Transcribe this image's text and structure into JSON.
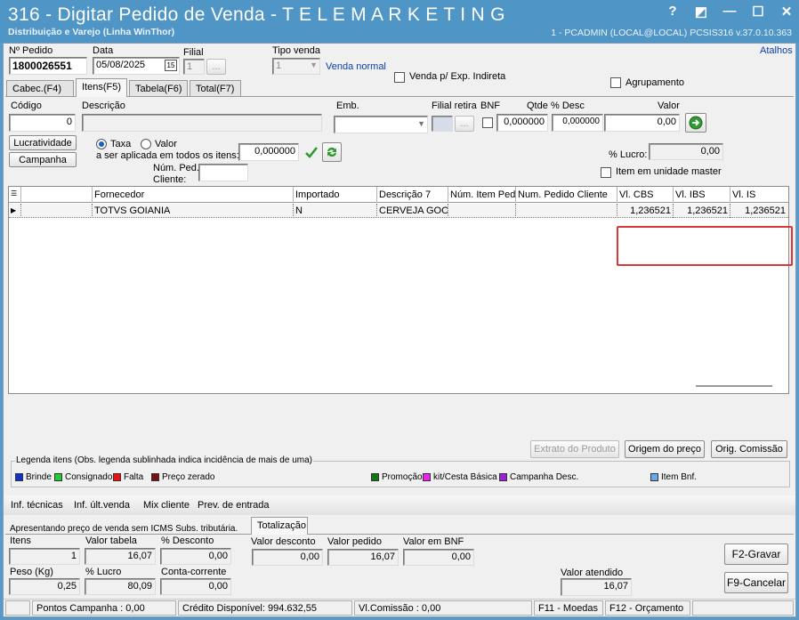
{
  "window": {
    "title": "316 - Digitar Pedido de Venda - T E L E M A R K E T I N G",
    "subtitle": "Distribuição e Varejo (Linha WinThor)",
    "session": "1 - PCADMIN (LOCAL@LOCAL)   PCSIS316  v.37.0.10.363",
    "buttons": {
      "help": "?",
      "restore": "◩",
      "minimize": "—",
      "maximize": "☐",
      "close": "✕"
    }
  },
  "header": {
    "pedido_label": "Nº Pedido",
    "pedido_value": "1800026551",
    "data_label": "Data",
    "data_value": "05/08/2025",
    "calendar_icon": "15",
    "filial_label": "Filial",
    "filial_value": "1",
    "ellipsis": "...",
    "tipo_venda_label": "Tipo venda",
    "tipo_venda_value": "1",
    "tipo_venda_desc": "Venda normal",
    "exp_indireta_label": "Venda p/ Exp. Indireta",
    "atalhos": "Atalhos",
    "agrupamento_label": "Agrupamento"
  },
  "tabs": [
    {
      "label": "Cabec.(F4)"
    },
    {
      "label": "Itens(F5)"
    },
    {
      "label": "Tabela(F6)"
    },
    {
      "label": "Total(F7)"
    }
  ],
  "item_form": {
    "codigo_label": "Código",
    "codigo_value": "0",
    "descricao_label": "Descrição",
    "descricao_value": "",
    "emb_label": "Emb.",
    "filial_retira_label": "Filial retira",
    "bnf_label": "BNF",
    "qtde_label": "Qtde",
    "qtde_value": "0,000000",
    "desc_label": "% Desc",
    "desc_value": "0,000000",
    "valor_label": "Valor",
    "valor_value": "0,00",
    "lucratividade_btn": "Lucratividade",
    "campanha_btn": "Campanha",
    "taxa_label": "Taxa",
    "valor_radio_label": "Valor",
    "aplicada_label": "a ser aplicada em todos os itens:",
    "aplicada_value": "0,000000",
    "num_ped_cliente_label1": "Núm. Ped.",
    "num_ped_cliente_label2": "Cliente:",
    "lucro_label": "% Lucro:",
    "lucro_value": "0,00",
    "unidade_master_label": "Item em unidade master"
  },
  "grid": {
    "headers": [
      "",
      "Fornecedor",
      "Importado",
      "Descrição 7",
      "Núm. Item Ped",
      "Num. Pedido Cliente",
      "Vl. CBS",
      "Vl. IBS",
      "Vl. IS"
    ],
    "rows": [
      [
        "",
        "TOTVS GOIANIA",
        "N",
        "CERVEJA GOOS",
        "",
        "",
        "1,236521",
        "1,236521",
        "1,236521"
      ]
    ]
  },
  "actions": {
    "extrato": "Extrato do Produto",
    "origem": "Origem do preço",
    "comissao": "Orig. Comissão"
  },
  "legend": {
    "title": "Legenda itens (Obs. legenda sublinhada indica incidência de mais de uma)",
    "items": [
      {
        "label": "Brinde",
        "color": "#1030d0"
      },
      {
        "label": "Consignado",
        "color": "#22cc33"
      },
      {
        "label": "Falta",
        "color": "#ee1111"
      },
      {
        "label": "Preço zerado",
        "color": "#7a1010"
      },
      {
        "label": "Promoção",
        "color": "#107a10"
      },
      {
        "label": "kit/Cesta Básica",
        "color": "#ee22ee"
      },
      {
        "label": "Campanha Desc.",
        "color": "#9a22dd"
      },
      {
        "label": "Item Bnf.",
        "color": "#66aaee"
      }
    ]
  },
  "bottom_tabs": [
    "Inf. técnicas",
    "Inf. últ.venda",
    "Mix cliente",
    "Prev. de entrada"
  ],
  "totals": {
    "note": "Apresentando preço de venda sem ICMS Subs. tributária.",
    "tab": "Totalização",
    "itens_label": "Itens",
    "itens_value": "1",
    "valor_tabela_label": "Valor tabela",
    "valor_tabela_value": "16,07",
    "pct_desconto_label": "% Desconto",
    "pct_desconto_value": "0,00",
    "valor_desconto_label": "Valor desconto",
    "valor_desconto_value": "0,00",
    "valor_pedido_label": "Valor pedido",
    "valor_pedido_value": "16,07",
    "valor_bnf_label": "Valor em BNF",
    "valor_bnf_value": "0,00",
    "peso_label": "Peso (Kg)",
    "peso_value": "0,25",
    "pct_lucro_label": "% Lucro",
    "pct_lucro_value": "80,09",
    "conta_corrente_label": "Conta-corrente",
    "conta_corrente_value": "0,00",
    "valor_atendido_label": "Valor atendido",
    "valor_atendido_value": "16,07",
    "gravar_btn": "F2-Gravar",
    "cancelar_btn": "F9-Cancelar"
  },
  "statusbar": {
    "pontos": "Pontos Campanha : 0,00",
    "credito": "Crédito Disponível: 994.632,55",
    "comissao": "Vl.Comissão : 0,00",
    "moedas": "F11 - Moedas",
    "orcamento": "F12 - Orçamento"
  },
  "colors": {
    "titlebar": "#4f95c6",
    "highlight": "#d9383a"
  }
}
